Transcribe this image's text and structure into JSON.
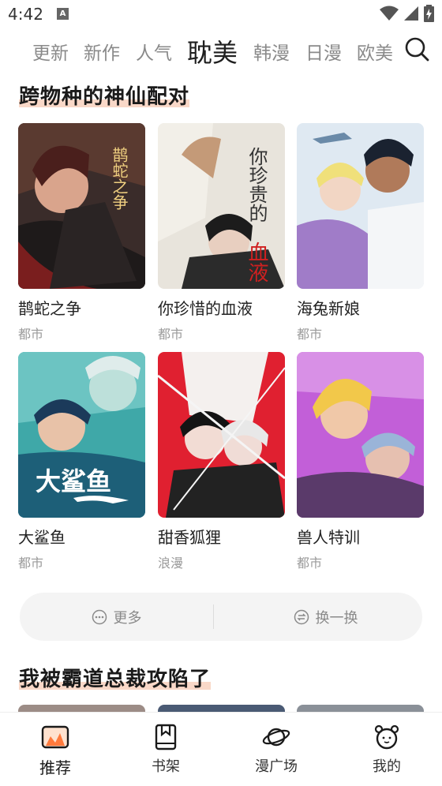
{
  "status_bar": {
    "time": "4:42",
    "notification_icon": "a-notification-icon"
  },
  "tabs": [
    {
      "label": "更新",
      "active": false
    },
    {
      "label": "新作",
      "active": false
    },
    {
      "label": "人气",
      "active": false
    },
    {
      "label": "耽美",
      "active": true
    },
    {
      "label": "韩漫",
      "active": false
    },
    {
      "label": "日漫",
      "active": false
    },
    {
      "label": "欧美",
      "active": false
    }
  ],
  "sections": [
    {
      "title": "跨物种的神仙配对",
      "items": [
        {
          "title": "鹊蛇之争",
          "genre": "都市",
          "cover_text": "鹊蛇之争"
        },
        {
          "title": "你珍惜的血液",
          "genre": "都市",
          "cover_text": "你珍贵的血液"
        },
        {
          "title": "海兔新娘",
          "genre": "都市",
          "cover_text": ""
        },
        {
          "title": "大鲨鱼",
          "genre": "都市",
          "cover_text": "大鲨鱼"
        },
        {
          "title": "甜香狐狸",
          "genre": "浪漫",
          "cover_text": ""
        },
        {
          "title": "兽人特训",
          "genre": "都市",
          "cover_text": ""
        }
      ],
      "actions": {
        "more": "更多",
        "refresh": "换一换"
      }
    },
    {
      "title": "我被霸道总裁攻陷了"
    }
  ],
  "bottom_nav": [
    {
      "label": "推荐",
      "icon": "recommend-icon",
      "active": true
    },
    {
      "label": "书架",
      "icon": "bookshelf-icon",
      "active": false
    },
    {
      "label": "漫广场",
      "icon": "planet-icon",
      "active": false
    },
    {
      "label": "我的",
      "icon": "profile-icon",
      "active": false
    }
  ],
  "colors": {
    "accent_highlight": "#f6c7b0",
    "active_icon": "#ff7a3d"
  }
}
